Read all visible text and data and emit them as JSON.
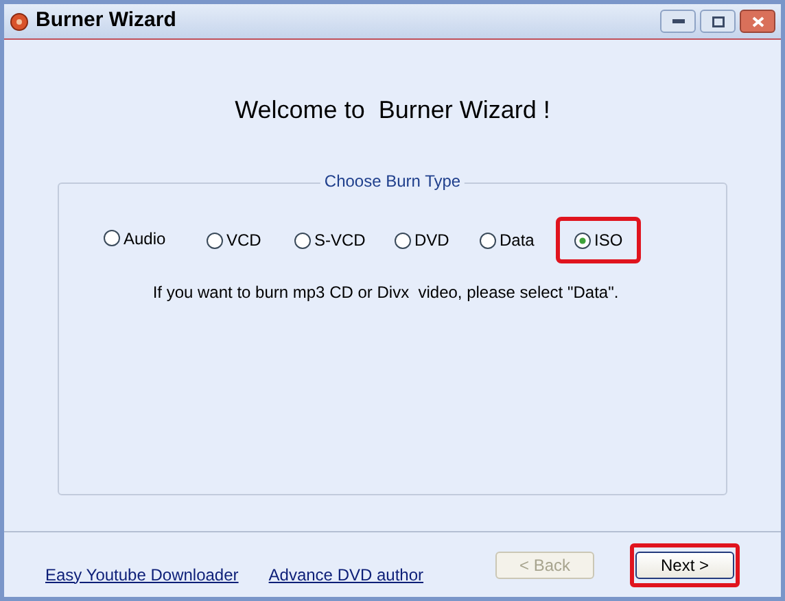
{
  "window": {
    "title": "Burner Wizard"
  },
  "heading": "Welcome to  Burner Wizard !",
  "group": {
    "title": "Choose Burn Type",
    "options": [
      {
        "label": "Audio",
        "selected": false,
        "highlighted": false
      },
      {
        "label": "VCD",
        "selected": false,
        "highlighted": false
      },
      {
        "label": "S-VCD",
        "selected": false,
        "highlighted": false
      },
      {
        "label": "DVD",
        "selected": false,
        "highlighted": false
      },
      {
        "label": "Data",
        "selected": false,
        "highlighted": false
      },
      {
        "label": "ISO",
        "selected": true,
        "highlighted": true
      }
    ],
    "note": "If you want to burn mp3 CD or Divx  video, please select \"Data\"."
  },
  "links": [
    "Easy Youtube Downloader",
    "Advance DVD author"
  ],
  "buttons": [
    {
      "label": "< Back",
      "disabled": true,
      "highlighted": false
    },
    {
      "label": "Next >",
      "disabled": false,
      "highlighted": true
    }
  ]
}
